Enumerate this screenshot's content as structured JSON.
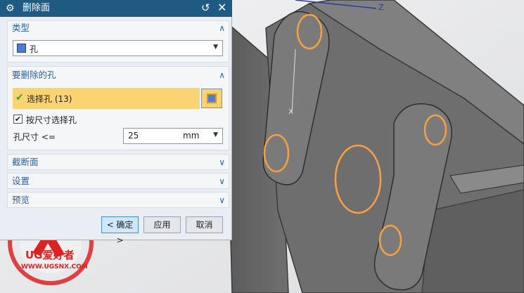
{
  "dialog": {
    "title": "删除面",
    "icons": {
      "settings": "gear-icon",
      "reset": "reset-icon",
      "close": "close-icon"
    },
    "sections": {
      "type": {
        "label": "类型",
        "state": "expanded",
        "value": "孔"
      },
      "holes": {
        "label": "要删除的孔",
        "state": "expanded",
        "select_label": "选择孔 (13)",
        "checkbox_label": "按尺寸选择孔",
        "checkbox_checked": true,
        "size_label": "孔尺寸 <=",
        "size_value": "25",
        "size_unit": "mm"
      },
      "cross_section": {
        "label": "截断面",
        "state": "collapsed"
      },
      "settings": {
        "label": "设置",
        "state": "collapsed"
      },
      "preview": {
        "label": "预览",
        "state": "collapsed"
      }
    },
    "buttons": {
      "ok": "< 确定 >",
      "apply": "应用",
      "cancel": "取消"
    }
  },
  "viewport": {
    "axis_label": "Z",
    "axis_marker": "X"
  },
  "watermark": {
    "brand": "UG爱好者",
    "url": "WWW.UGSNX.COM"
  },
  "colors": {
    "title_bar": "#1f5a82",
    "section_text": "#2a64a8",
    "selection_highlight": "#fad473",
    "hole_highlight": "#f7a040",
    "part_body": "#6b6b6b"
  }
}
